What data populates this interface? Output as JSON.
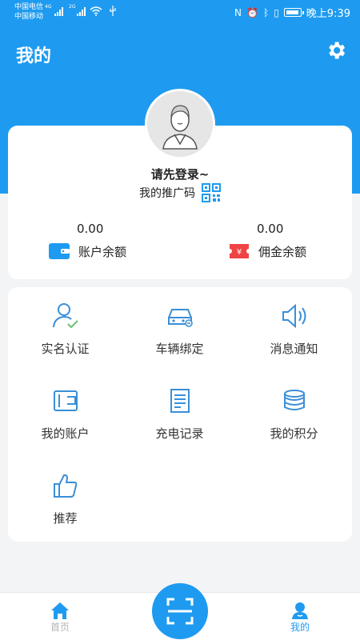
{
  "status_bar": {
    "carrier1": "中国电信",
    "carrier2": "中国移动",
    "net1": "4G",
    "net2": "2G",
    "time": "晚上9:39"
  },
  "header": {
    "title": "我的"
  },
  "profile": {
    "login_prompt": "请先登录~",
    "promo_code_label": "我的推广码"
  },
  "balances": [
    {
      "value": "0.00",
      "label": "账户余额",
      "icon": "wallet-icon"
    },
    {
      "value": "0.00",
      "label": "佣金余额",
      "icon": "commission-ticket-icon"
    }
  ],
  "menu": {
    "items": [
      {
        "label": "实名认证",
        "icon": "verified-user-icon"
      },
      {
        "label": "车辆绑定",
        "icon": "car-bind-icon"
      },
      {
        "label": "消息通知",
        "icon": "speaker-icon"
      },
      {
        "label": "我的账户",
        "icon": "account-wallet-icon"
      },
      {
        "label": "充电记录",
        "icon": "record-document-icon"
      },
      {
        "label": "我的积分",
        "icon": "coins-stack-icon"
      },
      {
        "label": "推荐",
        "icon": "thumbs-up-icon"
      }
    ]
  },
  "tabbar": {
    "home_label": "首页",
    "me_label": "我的"
  },
  "colors": {
    "primary": "#1e9bf0",
    "wallet": "#1e9bf0",
    "commission": "#ef4444",
    "icon_blue": "#3a8fd8"
  }
}
